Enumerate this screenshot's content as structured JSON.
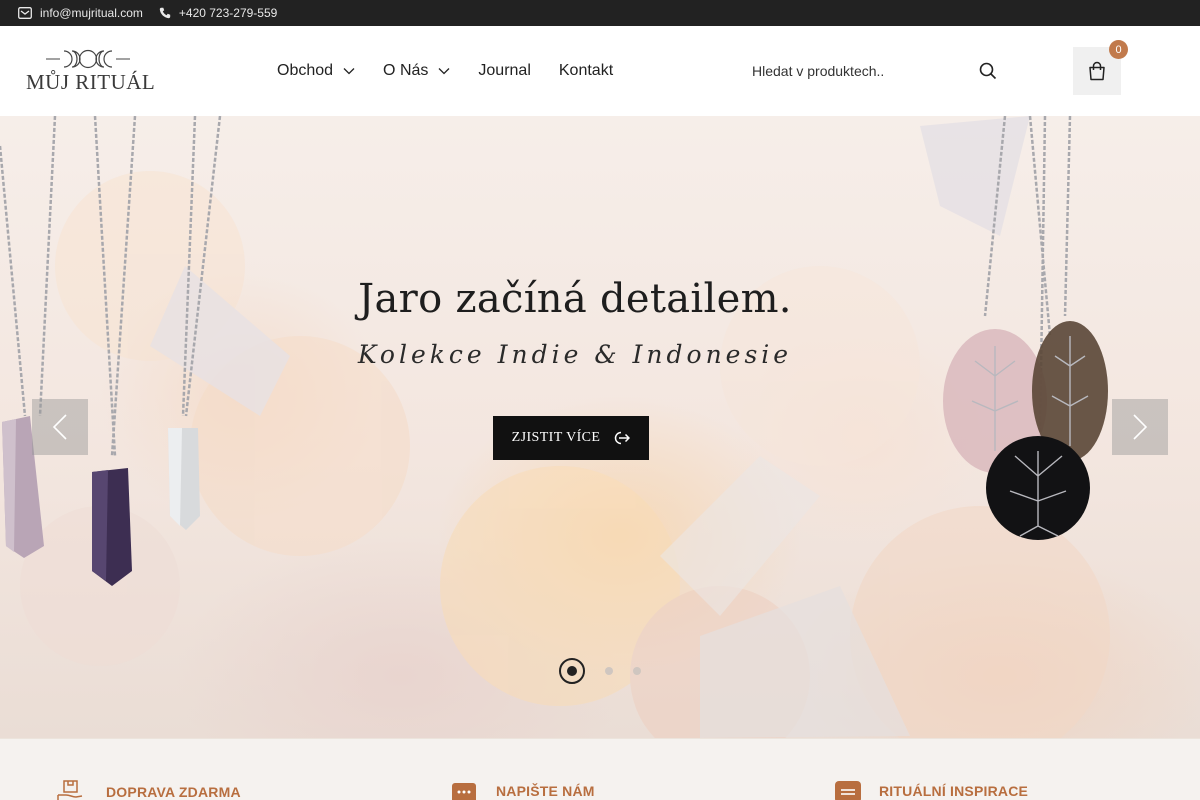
{
  "topbar": {
    "email": "info@mujritual.com",
    "phone": "+420 723-279-559"
  },
  "header": {
    "logo_text": "MŮJ RITUÁL",
    "nav": [
      {
        "label": "Obchod",
        "has_dropdown": true
      },
      {
        "label": "O Nás",
        "has_dropdown": true
      },
      {
        "label": "Journal",
        "has_dropdown": false
      },
      {
        "label": "Kontakt",
        "has_dropdown": false
      }
    ],
    "search_placeholder": "Hledat v produktech..",
    "cart_count": "0"
  },
  "hero": {
    "title": "Jaro začíná detailem.",
    "subtitle": "Kolekce Indie & Indonesie",
    "button_label": "ZJISTIT VÍCE",
    "slides_total": 3,
    "active_slide": 1
  },
  "features": [
    {
      "label": "DOPRAVA ZDARMA",
      "icon": "delivery-hand-icon"
    },
    {
      "label": "NAPIŠTE NÁM",
      "icon": "chat-icon"
    },
    {
      "label": "RITUÁLNÍ INSPIRACE",
      "icon": "note-icon"
    }
  ],
  "colors": {
    "topbar_bg": "#222222",
    "accent": "#b86e3f",
    "badge": "#c17a4c",
    "button_bg": "#111111"
  }
}
